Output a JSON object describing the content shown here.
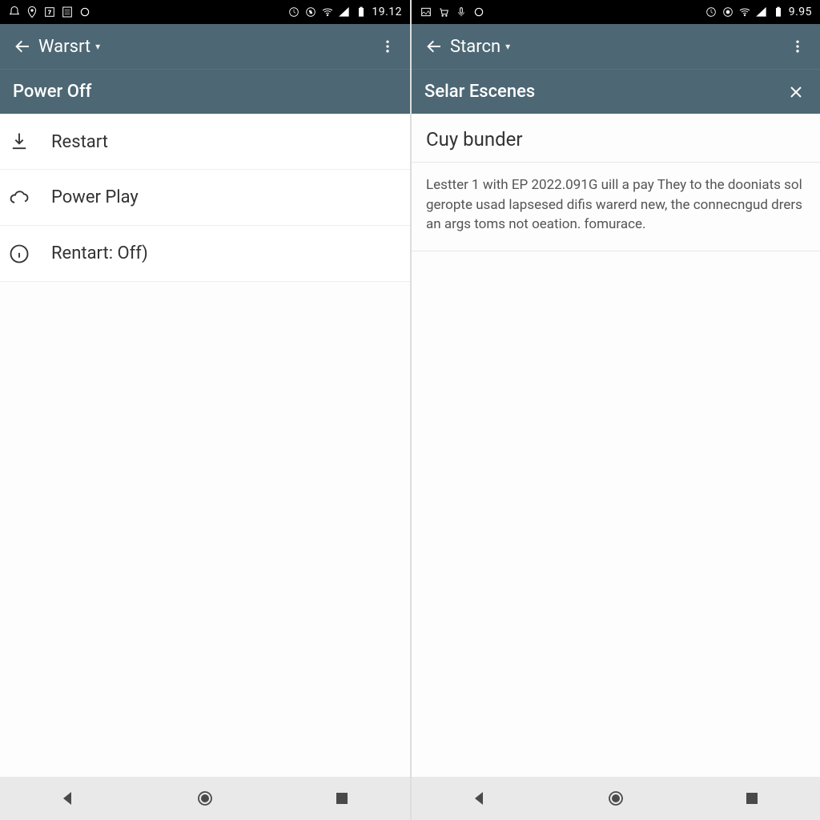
{
  "left": {
    "statusbar": {
      "clock": "19.12",
      "battery_pct": "%"
    },
    "appbar": {
      "title": "Warsrt"
    },
    "subheader": {
      "label": "Power Off"
    },
    "items": [
      {
        "icon": "download-icon",
        "label": "Restart"
      },
      {
        "icon": "cloud-icon",
        "label": "Power Play"
      },
      {
        "icon": "info-icon",
        "label": "Rentart: Off)"
      }
    ]
  },
  "right": {
    "statusbar": {
      "clock": "9.95",
      "battery_pct": ""
    },
    "appbar": {
      "title": "Starcn"
    },
    "subheader": {
      "label": "Selar Escenes"
    },
    "card": {
      "title": "Cuy bunder",
      "body": "Lestter 1 with EP 2022.091G uill a pay They to the dooniats sol geropte usad lapsesed difis warerd new, the connecngud drers an args toms not oeation. fomurace."
    }
  }
}
